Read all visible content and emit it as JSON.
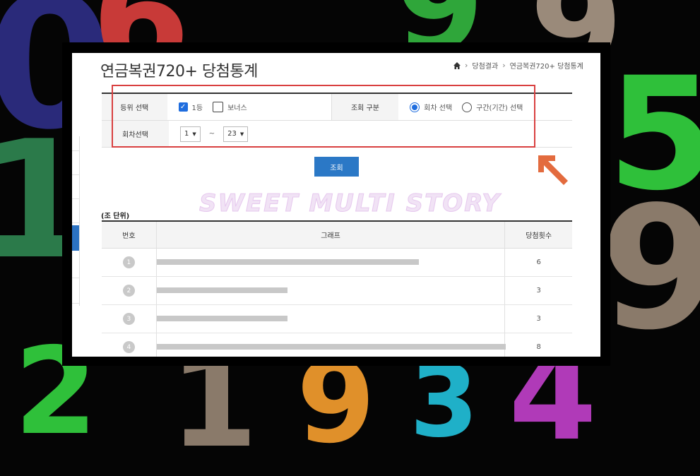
{
  "background_digits": [
    "0",
    "6",
    "9",
    "1",
    "5",
    "9",
    "4",
    "3",
    "2",
    "1",
    "9",
    "9"
  ],
  "title": "연금복권720+ 당첨통계",
  "breadcrumb": {
    "home_icon": "home-icon",
    "items": [
      "당첨결과",
      "연금복권720+ 당첨통계"
    ]
  },
  "filter": {
    "rank_label": "등위 선택",
    "rank_options": [
      {
        "label": "1등",
        "checked": true
      },
      {
        "label": "보너스",
        "checked": false
      }
    ],
    "query_type_label": "조회 구분",
    "query_type_options": [
      {
        "label": "회차 선택",
        "selected": true
      },
      {
        "label": "구간(기간) 선택",
        "selected": false
      }
    ],
    "round_label": "회차선택",
    "round_from": "1",
    "round_tilde": "~",
    "round_to": "23"
  },
  "query_button": "조회",
  "watermark": "SWEET MULTI STORY",
  "unit_note": "(조 단위)",
  "results": {
    "headers": [
      "번호",
      "그래프",
      "당첨횟수"
    ],
    "max_count": 8,
    "rows": [
      {
        "number": "1",
        "count": 6
      },
      {
        "number": "2",
        "count": 3
      },
      {
        "number": "3",
        "count": 3
      },
      {
        "number": "4",
        "count": 8
      }
    ]
  },
  "colors": {
    "accent": "#2b78c6",
    "highlight": "#d94040",
    "arrow": "#e36b3e",
    "bar": "#c8c8c8"
  }
}
